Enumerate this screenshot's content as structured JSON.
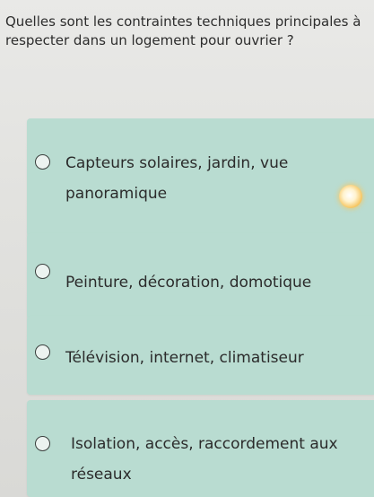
{
  "question": "Quelles sont les contraintes techniques principales à respecter dans un logement pour ouvrier ?",
  "options": [
    {
      "label": "Capteurs solaires, jardin, vue panoramique",
      "selected": false
    },
    {
      "label": "Peinture, décoration, domotique",
      "selected": false
    },
    {
      "label": "Télévision, internet, climatiseur",
      "selected": false
    },
    {
      "label": "Isolation, accès, raccordement aux réseaux",
      "selected": false
    }
  ],
  "colors": {
    "background": "#e4e4e1",
    "option_background": "#b9dcd1",
    "radio_border": "#3a3f3d",
    "text": "#2b2b2b"
  }
}
